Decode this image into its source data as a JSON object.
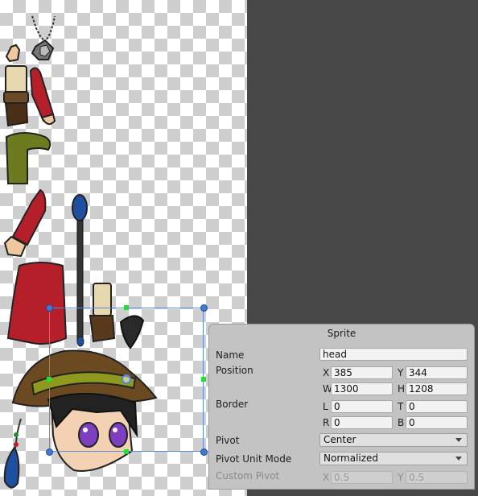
{
  "panel": {
    "title": "Sprite",
    "name_label": "Name",
    "name_value": "head",
    "position_label": "Position",
    "x_label": "X",
    "x_value": "385",
    "y_label": "Y",
    "y_value": "344",
    "w_label": "W",
    "w_value": "1300",
    "h_label": "H",
    "h_value": "1208",
    "border_label": "Border",
    "l_label": "L",
    "l_value": "0",
    "t_label": "T",
    "t_value": "0",
    "r_label": "R",
    "r_value": "0",
    "b_label": "B",
    "b_value": "0",
    "pivot_label": "Pivot",
    "pivot_value": "Center",
    "pivot_unit_label": "Pivot Unit Mode",
    "pivot_unit_value": "Normalized",
    "custom_pivot_label": "Custom Pivot",
    "cp_x_label": "X",
    "cp_x_value": "0.5",
    "cp_y_label": "Y",
    "cp_y_value": "0.5"
  },
  "colors": {
    "selection": "#5b8bd6",
    "handle": "#3d7ad6",
    "side_handle": "#22dd33",
    "panel_bg": "#c3c3c3"
  },
  "icons": [
    "dropdown-arrow-icon",
    "pivot-handle-icon"
  ]
}
